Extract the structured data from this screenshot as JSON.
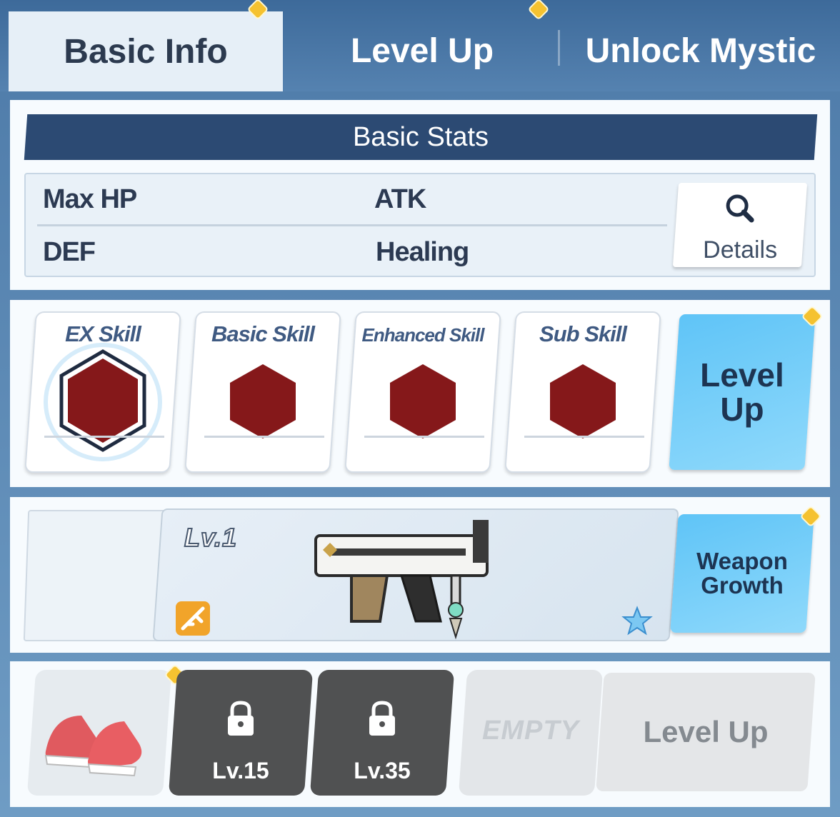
{
  "tabs": {
    "basic_info": "Basic Info",
    "level_up": "Level Up",
    "unlock_mystic": "Unlock Mystic"
  },
  "stats": {
    "header": "Basic Stats",
    "max_hp": "Max HP",
    "atk": "ATK",
    "def": "DEF",
    "healing": "Healing",
    "details_label": "Details"
  },
  "skills": {
    "items": [
      {
        "label": "EX Skill"
      },
      {
        "label": "Basic Skill"
      },
      {
        "label": "Enhanced Skill"
      },
      {
        "label": "Sub Skill"
      }
    ],
    "level_up_label_1": "Level",
    "level_up_label_2": "Up",
    "hex_color": "#85181a"
  },
  "weapon": {
    "level": "Lv.1",
    "growth_label_1": "Weapon",
    "growth_label_2": "Growth"
  },
  "equipment": {
    "slot2_level": "Lv.15",
    "slot3_level": "Lv.35",
    "empty_label": "EMPTY",
    "level_up_label": "Level Up"
  },
  "colors": {
    "accent_blue": "#5fc4f7",
    "header_navy": "#2c4a73",
    "notification": "#f5c230"
  }
}
